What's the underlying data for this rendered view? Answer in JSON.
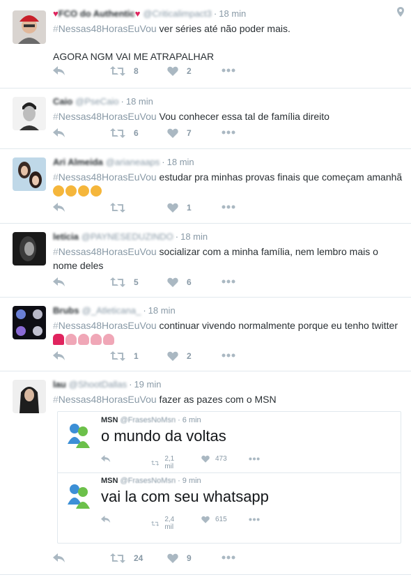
{
  "tweets": [
    {
      "fullname": "FCO do Authentic",
      "username": "@Criticalimpact3",
      "time": "18 min",
      "hashtag": "Nessas48HorasEuVou",
      "text": " ver séries até não poder mais.\n\nAGORA NGM VAI ME ATRAPALHAR",
      "retweets": "8",
      "likes": "2"
    },
    {
      "fullname": "Caio",
      "username": "@PseCaio",
      "time": "18 min",
      "hashtag": "Nessas48HorasEuVou",
      "text": " Vou conhecer essa tal de família direito",
      "retweets": "6",
      "likes": "7"
    },
    {
      "fullname": "Ari Almeida",
      "username": "@arianeaaps",
      "time": "18 min",
      "hashtag": "Nessas48HorasEuVou",
      "text": " estudar pra minhas provas finais que começam amanhã",
      "retweets": "",
      "likes": "1"
    },
    {
      "fullname": "letícia",
      "username": "@PAYNESEDUZINDO",
      "time": "18 min",
      "hashtag": "Nessas48HorasEuVou",
      "text": " socializar com a minha família, nem lembro mais o nome deles",
      "retweets": "5",
      "likes": "6"
    },
    {
      "fullname": "Brubs",
      "username": "@_Atleticana_",
      "time": "18 min",
      "hashtag": "Nessas48HorasEuVou",
      "text": " continuar vivendo normalmente porque eu tenho twitter",
      "retweets": "1",
      "likes": "2"
    },
    {
      "fullname": "lau",
      "username": "@ShootDallas",
      "time": "19 min",
      "hashtag": "Nessas48HorasEuVou",
      "text": " fazer as pazes com o MSN",
      "retweets": "24",
      "likes": "9"
    }
  ],
  "quoted": [
    {
      "fullname": "MSN",
      "username": "@FrasesNoMsn",
      "time": "6 min",
      "text": "o mundo da voltas",
      "retweets": "2,1 mil",
      "likes": "473"
    },
    {
      "fullname": "MSN",
      "username": "@FrasesNoMsn",
      "time": "9 min",
      "text": "vai la com seu whatsapp",
      "retweets": "2,4 mil",
      "likes": "615"
    }
  ],
  "symbols": {
    "hash": "#",
    "dot": "·"
  },
  "colors": {
    "heart": "#e0245e",
    "link": "#8899a6",
    "border": "#e1e8ed"
  }
}
